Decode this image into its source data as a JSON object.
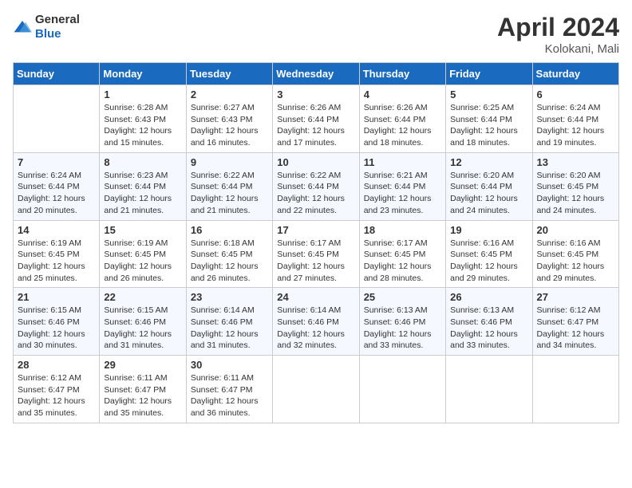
{
  "header": {
    "logo_general": "General",
    "logo_blue": "Blue",
    "month_title": "April 2024",
    "location": "Kolokani, Mali"
  },
  "days_of_week": [
    "Sunday",
    "Monday",
    "Tuesday",
    "Wednesday",
    "Thursday",
    "Friday",
    "Saturday"
  ],
  "weeks": [
    [
      {
        "day": "",
        "sunrise": "",
        "sunset": "",
        "daylight": ""
      },
      {
        "day": "1",
        "sunrise": "Sunrise: 6:28 AM",
        "sunset": "Sunset: 6:43 PM",
        "daylight": "Daylight: 12 hours and 15 minutes."
      },
      {
        "day": "2",
        "sunrise": "Sunrise: 6:27 AM",
        "sunset": "Sunset: 6:43 PM",
        "daylight": "Daylight: 12 hours and 16 minutes."
      },
      {
        "day": "3",
        "sunrise": "Sunrise: 6:26 AM",
        "sunset": "Sunset: 6:44 PM",
        "daylight": "Daylight: 12 hours and 17 minutes."
      },
      {
        "day": "4",
        "sunrise": "Sunrise: 6:26 AM",
        "sunset": "Sunset: 6:44 PM",
        "daylight": "Daylight: 12 hours and 18 minutes."
      },
      {
        "day": "5",
        "sunrise": "Sunrise: 6:25 AM",
        "sunset": "Sunset: 6:44 PM",
        "daylight": "Daylight: 12 hours and 18 minutes."
      },
      {
        "day": "6",
        "sunrise": "Sunrise: 6:24 AM",
        "sunset": "Sunset: 6:44 PM",
        "daylight": "Daylight: 12 hours and 19 minutes."
      }
    ],
    [
      {
        "day": "7",
        "sunrise": "Sunrise: 6:24 AM",
        "sunset": "Sunset: 6:44 PM",
        "daylight": "Daylight: 12 hours and 20 minutes."
      },
      {
        "day": "8",
        "sunrise": "Sunrise: 6:23 AM",
        "sunset": "Sunset: 6:44 PM",
        "daylight": "Daylight: 12 hours and 21 minutes."
      },
      {
        "day": "9",
        "sunrise": "Sunrise: 6:22 AM",
        "sunset": "Sunset: 6:44 PM",
        "daylight": "Daylight: 12 hours and 21 minutes."
      },
      {
        "day": "10",
        "sunrise": "Sunrise: 6:22 AM",
        "sunset": "Sunset: 6:44 PM",
        "daylight": "Daylight: 12 hours and 22 minutes."
      },
      {
        "day": "11",
        "sunrise": "Sunrise: 6:21 AM",
        "sunset": "Sunset: 6:44 PM",
        "daylight": "Daylight: 12 hours and 23 minutes."
      },
      {
        "day": "12",
        "sunrise": "Sunrise: 6:20 AM",
        "sunset": "Sunset: 6:44 PM",
        "daylight": "Daylight: 12 hours and 24 minutes."
      },
      {
        "day": "13",
        "sunrise": "Sunrise: 6:20 AM",
        "sunset": "Sunset: 6:45 PM",
        "daylight": "Daylight: 12 hours and 24 minutes."
      }
    ],
    [
      {
        "day": "14",
        "sunrise": "Sunrise: 6:19 AM",
        "sunset": "Sunset: 6:45 PM",
        "daylight": "Daylight: 12 hours and 25 minutes."
      },
      {
        "day": "15",
        "sunrise": "Sunrise: 6:19 AM",
        "sunset": "Sunset: 6:45 PM",
        "daylight": "Daylight: 12 hours and 26 minutes."
      },
      {
        "day": "16",
        "sunrise": "Sunrise: 6:18 AM",
        "sunset": "Sunset: 6:45 PM",
        "daylight": "Daylight: 12 hours and 26 minutes."
      },
      {
        "day": "17",
        "sunrise": "Sunrise: 6:17 AM",
        "sunset": "Sunset: 6:45 PM",
        "daylight": "Daylight: 12 hours and 27 minutes."
      },
      {
        "day": "18",
        "sunrise": "Sunrise: 6:17 AM",
        "sunset": "Sunset: 6:45 PM",
        "daylight": "Daylight: 12 hours and 28 minutes."
      },
      {
        "day": "19",
        "sunrise": "Sunrise: 6:16 AM",
        "sunset": "Sunset: 6:45 PM",
        "daylight": "Daylight: 12 hours and 29 minutes."
      },
      {
        "day": "20",
        "sunrise": "Sunrise: 6:16 AM",
        "sunset": "Sunset: 6:45 PM",
        "daylight": "Daylight: 12 hours and 29 minutes."
      }
    ],
    [
      {
        "day": "21",
        "sunrise": "Sunrise: 6:15 AM",
        "sunset": "Sunset: 6:46 PM",
        "daylight": "Daylight: 12 hours and 30 minutes."
      },
      {
        "day": "22",
        "sunrise": "Sunrise: 6:15 AM",
        "sunset": "Sunset: 6:46 PM",
        "daylight": "Daylight: 12 hours and 31 minutes."
      },
      {
        "day": "23",
        "sunrise": "Sunrise: 6:14 AM",
        "sunset": "Sunset: 6:46 PM",
        "daylight": "Daylight: 12 hours and 31 minutes."
      },
      {
        "day": "24",
        "sunrise": "Sunrise: 6:14 AM",
        "sunset": "Sunset: 6:46 PM",
        "daylight": "Daylight: 12 hours and 32 minutes."
      },
      {
        "day": "25",
        "sunrise": "Sunrise: 6:13 AM",
        "sunset": "Sunset: 6:46 PM",
        "daylight": "Daylight: 12 hours and 33 minutes."
      },
      {
        "day": "26",
        "sunrise": "Sunrise: 6:13 AM",
        "sunset": "Sunset: 6:46 PM",
        "daylight": "Daylight: 12 hours and 33 minutes."
      },
      {
        "day": "27",
        "sunrise": "Sunrise: 6:12 AM",
        "sunset": "Sunset: 6:47 PM",
        "daylight": "Daylight: 12 hours and 34 minutes."
      }
    ],
    [
      {
        "day": "28",
        "sunrise": "Sunrise: 6:12 AM",
        "sunset": "Sunset: 6:47 PM",
        "daylight": "Daylight: 12 hours and 35 minutes."
      },
      {
        "day": "29",
        "sunrise": "Sunrise: 6:11 AM",
        "sunset": "Sunset: 6:47 PM",
        "daylight": "Daylight: 12 hours and 35 minutes."
      },
      {
        "day": "30",
        "sunrise": "Sunrise: 6:11 AM",
        "sunset": "Sunset: 6:47 PM",
        "daylight": "Daylight: 12 hours and 36 minutes."
      },
      {
        "day": "",
        "sunrise": "",
        "sunset": "",
        "daylight": ""
      },
      {
        "day": "",
        "sunrise": "",
        "sunset": "",
        "daylight": ""
      },
      {
        "day": "",
        "sunrise": "",
        "sunset": "",
        "daylight": ""
      },
      {
        "day": "",
        "sunrise": "",
        "sunset": "",
        "daylight": ""
      }
    ]
  ]
}
